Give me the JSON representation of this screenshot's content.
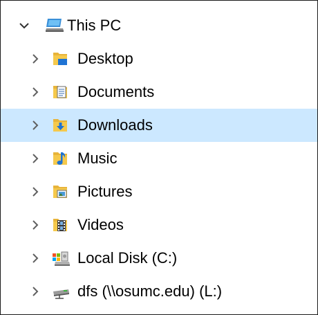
{
  "tree": {
    "root": {
      "label": "This PC",
      "icon": "computer-icon",
      "expanded": true
    },
    "items": [
      {
        "label": "Desktop",
        "icon": "desktop-folder-icon"
      },
      {
        "label": "Documents",
        "icon": "documents-folder-icon"
      },
      {
        "label": "Downloads",
        "icon": "downloads-folder-icon",
        "selected": true
      },
      {
        "label": "Music",
        "icon": "music-folder-icon"
      },
      {
        "label": "Pictures",
        "icon": "pictures-folder-icon"
      },
      {
        "label": "Videos",
        "icon": "videos-folder-icon"
      },
      {
        "label": "Local Disk (C:)",
        "icon": "local-disk-icon"
      },
      {
        "label": "dfs (\\\\osumc.edu) (L:)",
        "icon": "network-drive-icon"
      }
    ]
  },
  "colors": {
    "selection": "#cce8ff",
    "folder": "#e8b43a",
    "accent": "#1e73d4",
    "chevron": "#606060"
  }
}
